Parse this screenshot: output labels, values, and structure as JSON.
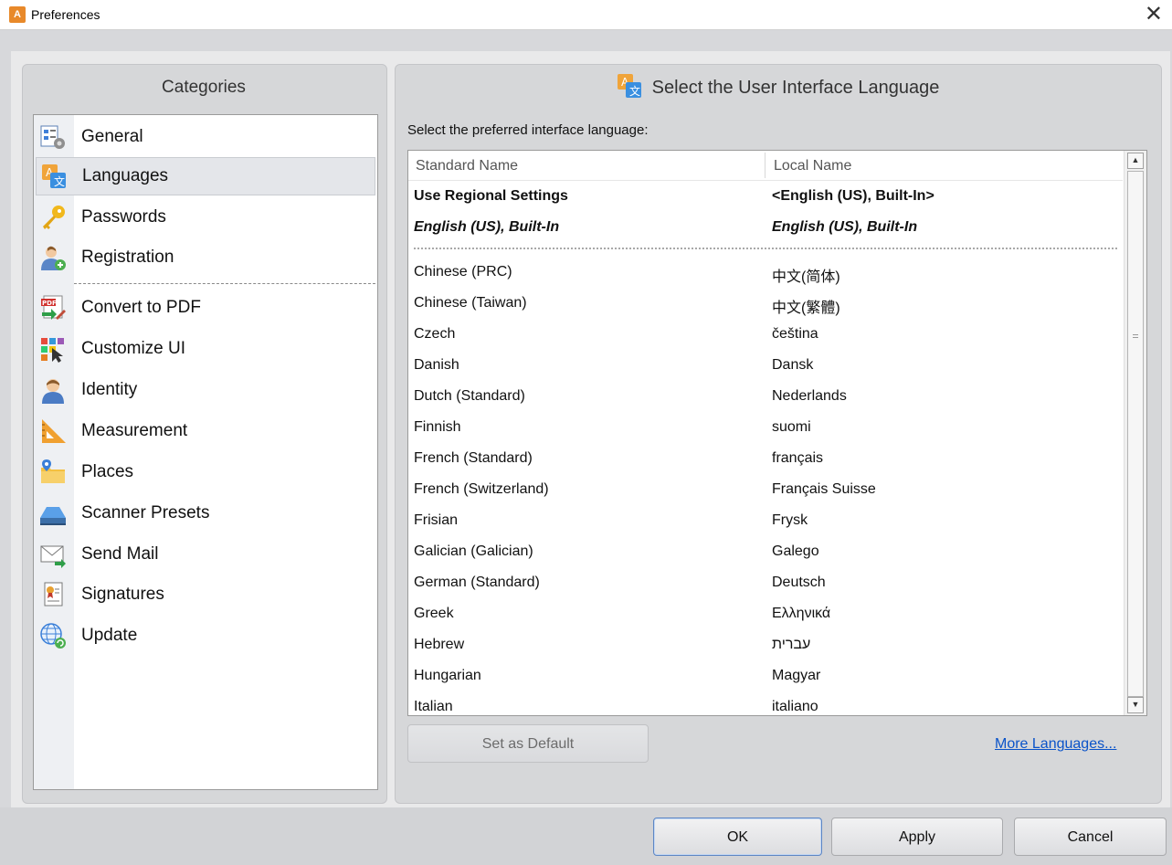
{
  "window": {
    "title": "Preferences",
    "close_glyph": "✕"
  },
  "categories": {
    "header": "Categories",
    "items": [
      {
        "label": "General",
        "icon": "general-settings-icon"
      },
      {
        "label": "Languages",
        "icon": "languages-icon",
        "selected": true
      },
      {
        "label": "Passwords",
        "icon": "key-icon"
      },
      {
        "label": "Registration",
        "icon": "registration-user-icon"
      },
      {
        "label": "Convert to PDF",
        "icon": "convert-pdf-icon"
      },
      {
        "label": "Customize UI",
        "icon": "customize-ui-icon"
      },
      {
        "label": "Identity",
        "icon": "identity-user-icon"
      },
      {
        "label": "Measurement",
        "icon": "ruler-triangle-icon"
      },
      {
        "label": "Places",
        "icon": "places-folder-icon"
      },
      {
        "label": "Scanner Presets",
        "icon": "scanner-icon"
      },
      {
        "label": "Send Mail",
        "icon": "mail-icon"
      },
      {
        "label": "Signatures",
        "icon": "signature-certificate-icon"
      },
      {
        "label": "Update",
        "icon": "update-globe-icon"
      }
    ]
  },
  "languages": {
    "header": "Select the User Interface Language",
    "prompt": "Select the preferred interface language:",
    "columns": [
      "Standard Name",
      "Local Name"
    ],
    "special_rows": [
      {
        "standard": "Use Regional Settings",
        "local": "<English (US), Built-In>"
      },
      {
        "standard": "English (US), Built-In",
        "local": "English (US), Built-In"
      }
    ],
    "rows": [
      {
        "standard": "Chinese (PRC)",
        "local": "中文(简体)"
      },
      {
        "standard": "Chinese (Taiwan)",
        "local": "中文(繁體)"
      },
      {
        "standard": "Czech",
        "local": "čeština"
      },
      {
        "standard": "Danish",
        "local": "Dansk"
      },
      {
        "standard": "Dutch (Standard)",
        "local": "Nederlands"
      },
      {
        "standard": "Finnish",
        "local": "suomi"
      },
      {
        "standard": "French (Standard)",
        "local": "français"
      },
      {
        "standard": "French (Switzerland)",
        "local": "Français Suisse"
      },
      {
        "standard": "Frisian",
        "local": "Frysk"
      },
      {
        "standard": "Galician (Galician)",
        "local": "Galego"
      },
      {
        "standard": "German (Standard)",
        "local": "Deutsch"
      },
      {
        "standard": "Greek",
        "local": "Ελληνικά"
      },
      {
        "standard": "Hebrew",
        "local": "עברית"
      },
      {
        "standard": "Hungarian",
        "local": "Magyar"
      },
      {
        "standard": "Italian",
        "local": "italiano"
      }
    ],
    "set_default_label": "Set as Default",
    "more_languages_label": "More Languages..."
  },
  "footer": {
    "ok_label": "OK",
    "apply_label": "Apply",
    "cancel_label": "Cancel"
  }
}
